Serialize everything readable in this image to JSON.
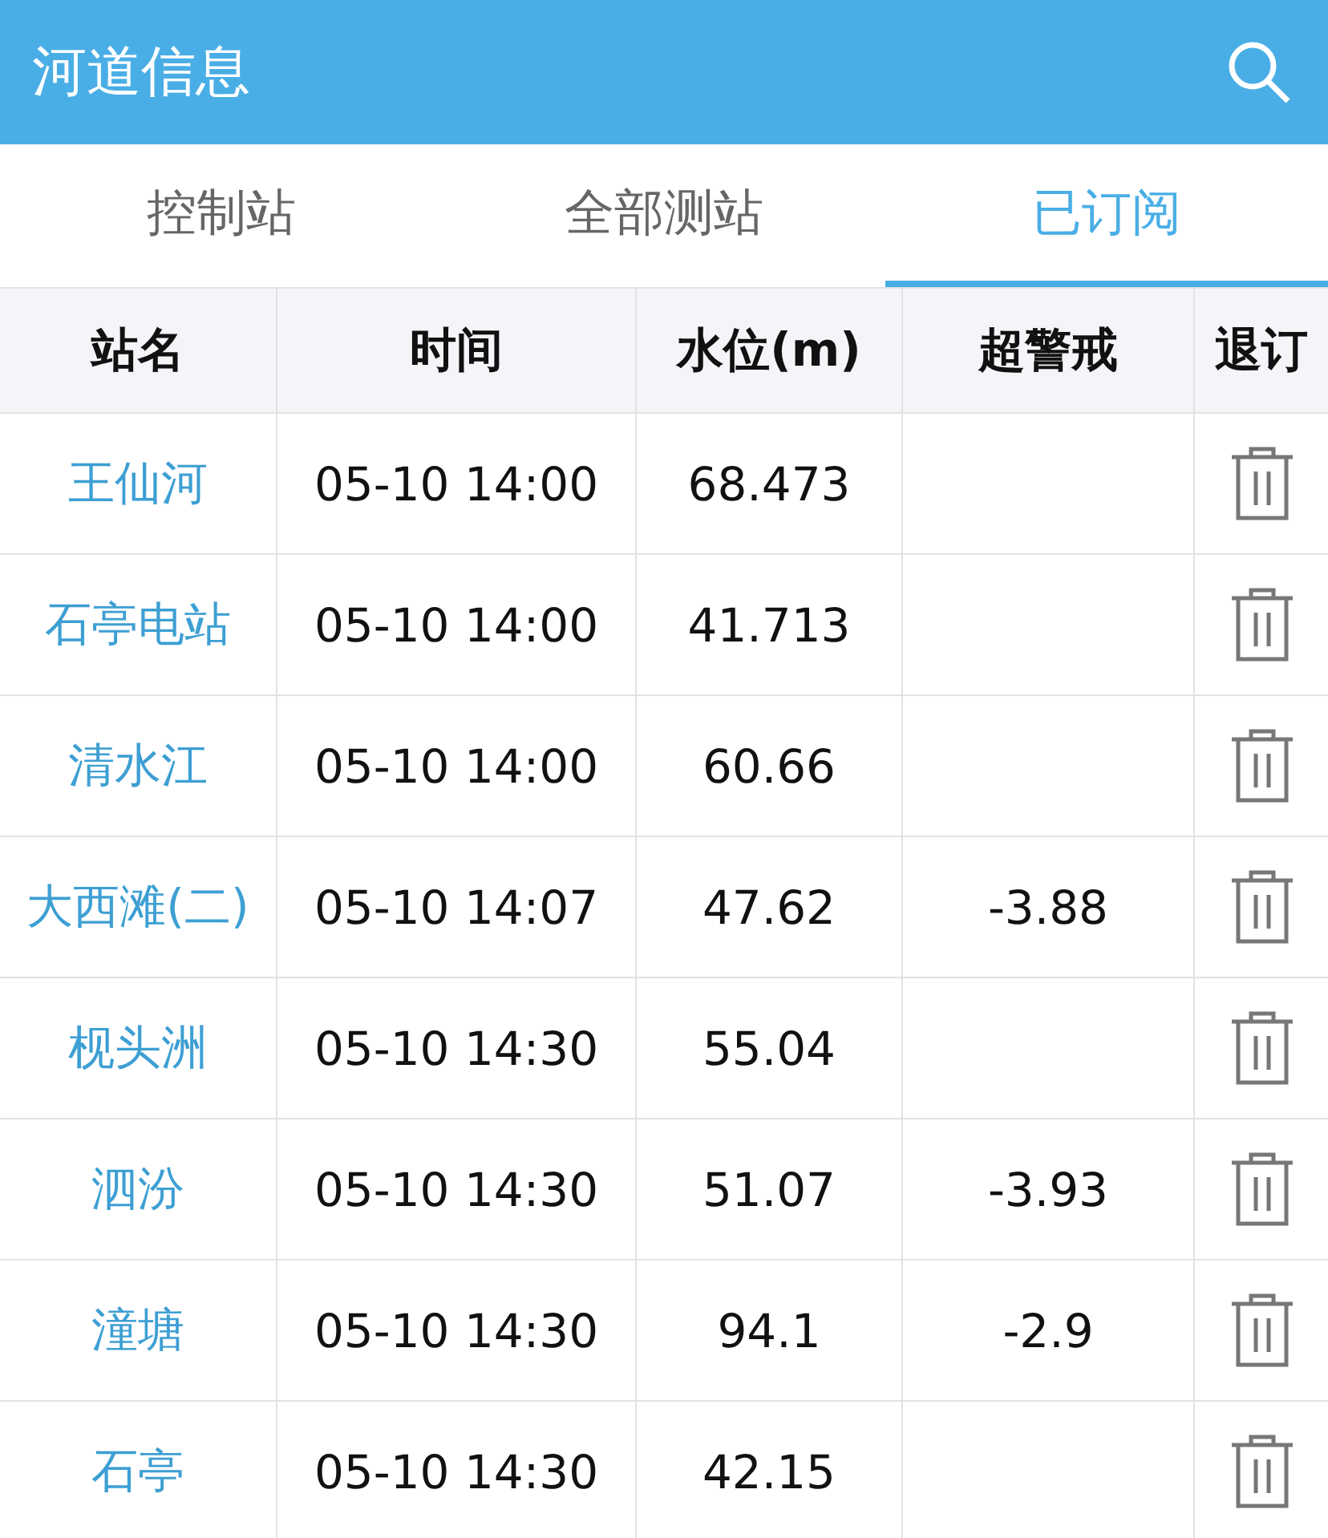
{
  "header": {
    "title": "河道信息"
  },
  "tabs": [
    {
      "label": "控制站",
      "selected": false
    },
    {
      "label": "全部测站",
      "selected": false
    },
    {
      "label": "已订阅",
      "selected": true
    }
  ],
  "table": {
    "columns": [
      "站名",
      "时间",
      "水位(m)",
      "超警戒",
      "退订"
    ],
    "rows": [
      {
        "station": "王仙河",
        "time": "05-10 14:00",
        "level_m": "68.473"
      },
      {
        "station": "石亭电站",
        "time": "05-10 14:00",
        "level_m": "41.713"
      },
      {
        "station": "清水江",
        "time": "05-10 14:00",
        "level_m": "60.66"
      },
      {
        "station": "大西滩(二)",
        "time": "05-10 14:07",
        "level_m": "47.62",
        "over_warning": "-3.88"
      },
      {
        "station": "枧头洲",
        "time": "05-10 14:30",
        "level_m": "55.04"
      },
      {
        "station": "泗汾",
        "time": "05-10 14:30",
        "level_m": "51.07",
        "over_warning": "-3.93"
      },
      {
        "station": "潼塘",
        "time": "05-10 14:30",
        "level_m": "94.1",
        "over_warning": "-2.9"
      },
      {
        "station": "石亭",
        "time": "05-10 14:30",
        "level_m": "42.15"
      }
    ]
  }
}
